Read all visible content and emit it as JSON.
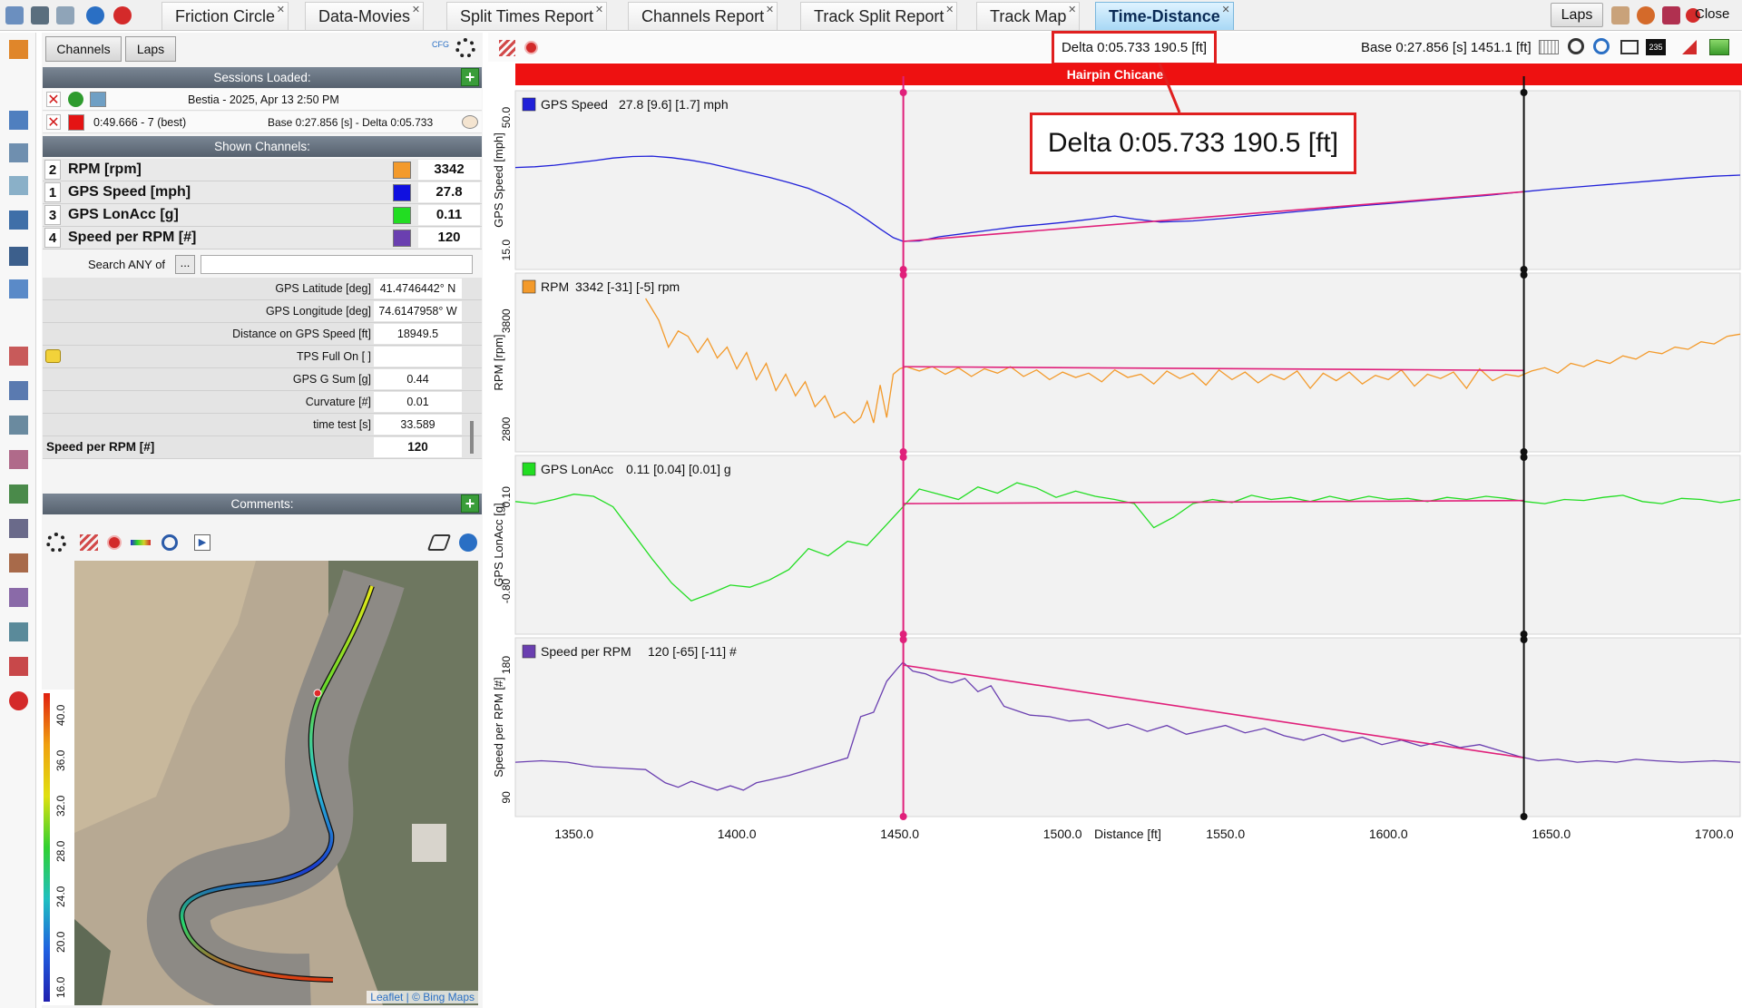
{
  "tabs": [
    {
      "label": "Friction Circle",
      "active": false
    },
    {
      "label": "Data-Movies",
      "active": false
    },
    {
      "label": "Split Times Report",
      "active": false
    },
    {
      "label": "Channels Report",
      "active": false
    },
    {
      "label": "Track Split Report",
      "active": false
    },
    {
      "label": "Track Map",
      "active": false
    },
    {
      "label": "Time-Distance",
      "active": true
    }
  ],
  "top_right": {
    "laps_label": "Laps",
    "close_label": "Close"
  },
  "panel": {
    "tab_channels": "Channels",
    "tab_laps": "Laps",
    "cfg_label": "CFG",
    "sessions_title": "Sessions Loaded:",
    "sessions": [
      {
        "text": "Bestia - 2025, Apr 13 2:50 PM",
        "color": "#2e9b2e"
      },
      {
        "text": "0:49.666 - 7 (best)",
        "detail": "Base 0:27.856 [s] - Delta 0:05.733",
        "color": "#e41414"
      }
    ],
    "shown_channels_title": "Shown Channels:",
    "channels": [
      {
        "num": "2",
        "name": "RPM [rpm]",
        "color": "#f39a2b",
        "value": "3342"
      },
      {
        "num": "1",
        "name": "GPS Speed [mph]",
        "color": "#1010e0",
        "value": "27.8"
      },
      {
        "num": "3",
        "name": "GPS LonAcc [g]",
        "color": "#22dd22",
        "value": "0.11"
      },
      {
        "num": "4",
        "name": "Speed per RPM [#]",
        "color": "#6a3fb0",
        "value": "120"
      }
    ],
    "search_label": "Search ANY of",
    "search_button": "...",
    "search_value": "",
    "properties": [
      {
        "label": "GPS Latitude [deg]",
        "value": "41.4746442° N"
      },
      {
        "label": "GPS Longitude [deg]",
        "value": "74.6147958° W"
      },
      {
        "label": "Distance on GPS Speed [ft]",
        "value": "18949.5"
      },
      {
        "label": "TPS Full On [ ]",
        "value": ""
      },
      {
        "label": "GPS G Sum [g]",
        "value": "0.44"
      },
      {
        "label": "Curvature [#]",
        "value": "0.01"
      },
      {
        "label": "time test [s]",
        "value": "33.589"
      },
      {
        "label": "Speed per RPM [#]",
        "value": "120"
      }
    ],
    "comments_title": "Comments:",
    "map_attribution_leaflet": "Leaflet",
    "map_attribution_bing": "| © Bing Maps",
    "scale_ticks": [
      "40.0",
      "36.0",
      "32.0",
      "28.0",
      "24.0",
      "20.0",
      "16.0"
    ]
  },
  "chart_toolbar": {
    "base_text": "Base 0:27.856 [s] 1451.1 [ft]",
    "delta_text": "Delta 0:05.733 190.5 [ft]"
  },
  "chart_data": {
    "type": "line",
    "section_label": "Hairpin Chicane",
    "callout": "Delta 0:05.733 190.5 [ft]",
    "xlabel": "Distance [ft]",
    "xlim": [
      1332,
      1708
    ],
    "x_ticks": [
      1350,
      1400,
      1450,
      1500,
      1550,
      1600,
      1650,
      1700
    ],
    "x_tick_labels": [
      "1350.0",
      "1400.0",
      "1450.0",
      "1500.0",
      "1550.0",
      "1600.0",
      "1650.0",
      "1700.0"
    ],
    "cursor_x": 1451.1,
    "end_cursor_x": 1641.6,
    "colors": {
      "section_bar": "#ee1111",
      "cursor": "#e0207a",
      "end_cursor": "#111111",
      "delta_line": "#e0207a"
    },
    "panels": [
      {
        "legend": "GPS Speed",
        "readout": "27.8 [9.6] [1.7]  mph",
        "ylabel": "GPS Speed [mph]",
        "color": "#2020d8",
        "ylim": [
          13,
          53
        ],
        "y_ticks": [
          15.0,
          50.0
        ],
        "y_tick_labels": [
          "15.0",
          "50.0"
        ],
        "x": [
          1332,
          1338,
          1344,
          1350,
          1356,
          1362,
          1368,
          1374,
          1380,
          1386,
          1392,
          1398,
          1404,
          1410,
          1416,
          1422,
          1428,
          1434,
          1440,
          1444,
          1448,
          1451,
          1456,
          1462,
          1470,
          1478,
          1486,
          1494,
          1500,
          1506,
          1510,
          1516,
          1522,
          1530,
          1540,
          1550,
          1560,
          1570,
          1580,
          1590,
          1600,
          1610,
          1620,
          1630,
          1640,
          1650,
          1660,
          1670,
          1680,
          1690,
          1700,
          1708
        ],
        "y": [
          38.0,
          38.2,
          38.6,
          39.2,
          39.8,
          40.5,
          40.9,
          41.0,
          40.6,
          39.9,
          39.0,
          37.8,
          36.6,
          35.4,
          34.0,
          32.5,
          30.3,
          27.6,
          24.2,
          21.8,
          19.5,
          18.5,
          18.6,
          19.7,
          20.6,
          21.5,
          22.4,
          23.0,
          23.5,
          24.1,
          24.5,
          25.2,
          24.4,
          23.6,
          23.9,
          24.6,
          25.4,
          26.2,
          27.0,
          27.8,
          28.5,
          29.2,
          29.9,
          30.6,
          31.5,
          32.3,
          33.0,
          33.7,
          34.4,
          35.1,
          35.7,
          36.0
        ],
        "delta": {
          "x0": 1451.1,
          "y0": 18.5,
          "x1": 1641.6,
          "y1": 31.6
        }
      },
      {
        "legend": "RPM",
        "readout": "3342 [-31] [-5]  rpm",
        "ylabel": "RPM [rpm]",
        "color": "#f39a2b",
        "ylim": [
          2700,
          4100
        ],
        "y_ticks": [
          2800,
          3800
        ],
        "y_tick_labels": [
          "2800",
          "3800"
        ],
        "x": [
          1372,
          1376,
          1379,
          1382,
          1385,
          1388,
          1391,
          1394,
          1397,
          1400,
          1403,
          1406,
          1409,
          1412,
          1415,
          1418,
          1421,
          1424,
          1427,
          1430,
          1433,
          1436,
          1438,
          1440,
          1442,
          1444,
          1446,
          1448,
          1450,
          1452,
          1456,
          1460,
          1464,
          1468,
          1472,
          1476,
          1480,
          1484,
          1488,
          1492,
          1496,
          1500,
          1504,
          1508,
          1512,
          1516,
          1520,
          1524,
          1528,
          1532,
          1536,
          1540,
          1544,
          1548,
          1552,
          1556,
          1560,
          1564,
          1568,
          1572,
          1576,
          1580,
          1584,
          1588,
          1592,
          1596,
          1600,
          1604,
          1608,
          1612,
          1616,
          1620,
          1624,
          1628,
          1632,
          1636,
          1640,
          1644,
          1648,
          1652,
          1656,
          1660,
          1664,
          1668,
          1672,
          1676,
          1680,
          1684,
          1688,
          1692,
          1696,
          1700,
          1704,
          1708
        ],
        "y": [
          4050,
          3850,
          3600,
          3750,
          3700,
          3550,
          3680,
          3500,
          3600,
          3400,
          3550,
          3300,
          3450,
          3200,
          3350,
          3150,
          3280,
          3050,
          3150,
          2950,
          3000,
          2900,
          2950,
          3100,
          2900,
          3250,
          2950,
          3350,
          3400,
          3420,
          3380,
          3420,
          3350,
          3410,
          3330,
          3400,
          3360,
          3420,
          3330,
          3390,
          3300,
          3370,
          3320,
          3360,
          3280,
          3390,
          3320,
          3350,
          3260,
          3380,
          3310,
          3360,
          3250,
          3390,
          3300,
          3370,
          3270,
          3350,
          3300,
          3380,
          3220,
          3360,
          3290,
          3370,
          3260,
          3340,
          3300,
          3390,
          3240,
          3350,
          3310,
          3370,
          3220,
          3400,
          3290,
          3350,
          3330,
          3380,
          3410,
          3360,
          3450,
          3420,
          3480,
          3450,
          3520,
          3490,
          3560,
          3540,
          3600,
          3580,
          3650,
          3630,
          3700,
          3720
        ],
        "delta": {
          "x0": 1451.1,
          "y0": 3420,
          "x1": 1641.6,
          "y1": 3385
        }
      },
      {
        "legend": "GPS LonAcc",
        "readout": "0.11 [0.04] [0.01]  g",
        "ylabel": "GPS LonAcc [g]",
        "color": "#22dd22",
        "ylim": [
          -1.1,
          0.35
        ],
        "y_ticks": [
          -0.8,
          0.1
        ],
        "y_tick_labels": [
          "-0.80",
          "0.10"
        ],
        "x": [
          1332,
          1338,
          1344,
          1350,
          1356,
          1362,
          1368,
          1374,
          1380,
          1386,
          1392,
          1398,
          1404,
          1410,
          1416,
          1422,
          1428,
          1434,
          1440,
          1446,
          1451,
          1456,
          1462,
          1468,
          1474,
          1480,
          1486,
          1492,
          1498,
          1504,
          1510,
          1516,
          1522,
          1528,
          1534,
          1540,
          1546,
          1552,
          1558,
          1564,
          1570,
          1576,
          1582,
          1588,
          1594,
          1600,
          1606,
          1612,
          1618,
          1624,
          1630,
          1636,
          1642,
          1648,
          1654,
          1660,
          1666,
          1672,
          1678,
          1684,
          1690,
          1696,
          1702,
          1708
        ],
        "y": [
          0.1,
          0.08,
          0.12,
          0.17,
          0.15,
          0.05,
          -0.2,
          -0.45,
          -0.68,
          -0.85,
          -0.78,
          -0.7,
          -0.72,
          -0.65,
          -0.55,
          -0.35,
          -0.42,
          -0.28,
          -0.32,
          -0.12,
          0.05,
          0.22,
          0.17,
          0.12,
          0.24,
          0.18,
          0.28,
          0.23,
          0.14,
          0.2,
          0.15,
          0.12,
          0.08,
          -0.15,
          -0.05,
          0.08,
          0.12,
          0.09,
          0.16,
          0.12,
          0.14,
          0.1,
          0.15,
          0.11,
          0.15,
          0.12,
          0.13,
          0.1,
          0.14,
          0.12,
          0.15,
          0.13,
          0.1,
          0.08,
          0.12,
          0.11,
          0.14,
          0.16,
          0.1,
          0.08,
          0.13,
          0.12,
          0.09,
          0.12
        ],
        "delta": {
          "x0": 1451.1,
          "y0": 0.08,
          "x1": 1641.6,
          "y1": 0.11
        }
      },
      {
        "legend": "Speed per RPM",
        "readout": "120 [-65] [-11]  #",
        "ylabel": "Speed per RPM [#]",
        "color": "#6a3fb0",
        "ylim": [
          85,
          188
        ],
        "y_ticks": [
          90,
          180
        ],
        "y_tick_labels": [
          "90",
          "180"
        ],
        "x": [
          1332,
          1340,
          1348,
          1356,
          1364,
          1372,
          1378,
          1382,
          1386,
          1390,
          1394,
          1398,
          1402,
          1406,
          1410,
          1416,
          1422,
          1428,
          1434,
          1438,
          1442,
          1446,
          1449,
          1451,
          1454,
          1458,
          1462,
          1466,
          1470,
          1474,
          1478,
          1482,
          1486,
          1490,
          1496,
          1502,
          1508,
          1514,
          1520,
          1526,
          1532,
          1538,
          1544,
          1550,
          1556,
          1562,
          1568,
          1574,
          1580,
          1586,
          1592,
          1598,
          1604,
          1610,
          1616,
          1622,
          1628,
          1634,
          1640,
          1646,
          1652,
          1658,
          1664,
          1670,
          1676,
          1682,
          1690,
          1700,
          1708
        ],
        "y": [
          117,
          118,
          117,
          114,
          113,
          112,
          103,
          100,
          104,
          101,
          98,
          101,
          98,
          103,
          105,
          108,
          112,
          116,
          120,
          148,
          151,
          172,
          180,
          185,
          179,
          177,
          173,
          171,
          174,
          165,
          169,
          155,
          152,
          149,
          148,
          145,
          146,
          140,
          143,
          138,
          142,
          136,
          139,
          142,
          137,
          140,
          135,
          132,
          136,
          131,
          134,
          129,
          132,
          128,
          131,
          127,
          129,
          125,
          121,
          118,
          119,
          117,
          118,
          117,
          119,
          118,
          117,
          118,
          117
        ],
        "delta": {
          "x0": 1451.1,
          "y0": 183,
          "x1": 1641.6,
          "y1": 120
        }
      }
    ]
  }
}
